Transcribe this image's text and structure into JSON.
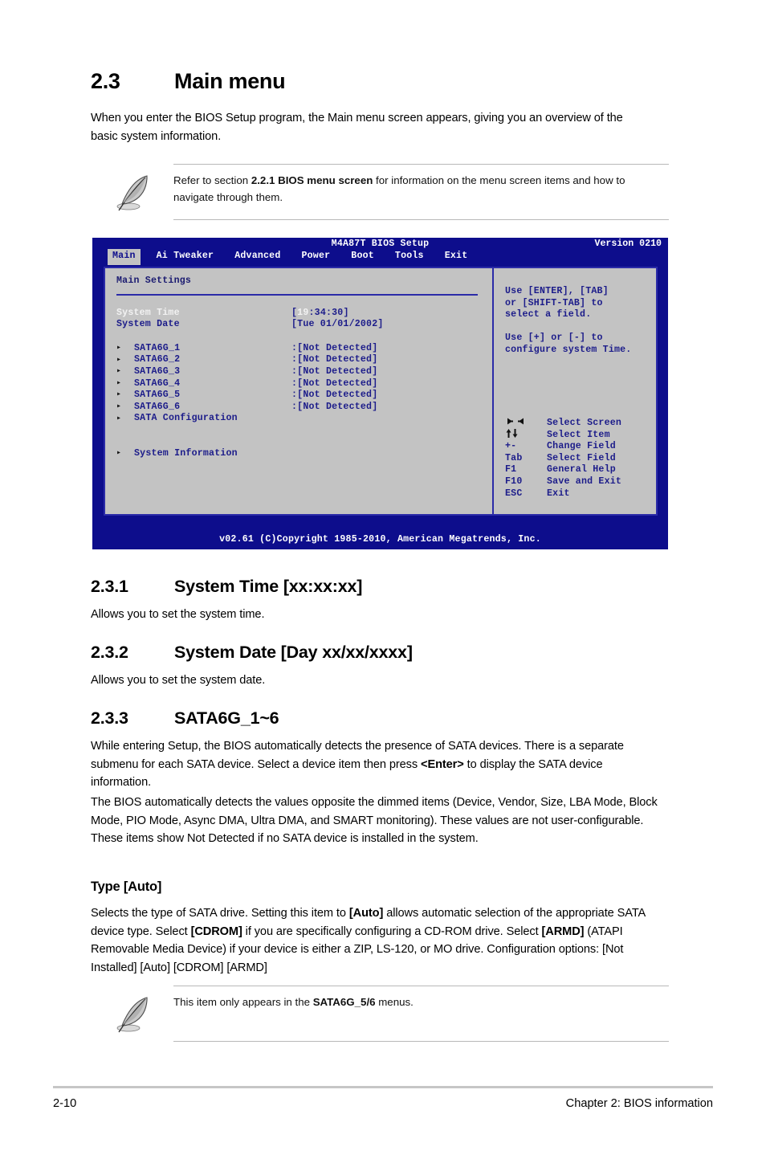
{
  "section": {
    "number": "2.3",
    "title": "Main menu",
    "intro": "When you enter the BIOS Setup program, the Main menu screen appears, giving you an overview of the basic system information."
  },
  "note_top": {
    "icon": "feather-pen-icon",
    "text_before": "Refer to section ",
    "bold": "2.2.1 BIOS menu screen",
    "text_after": " for information on the menu screen items and how to navigate through them."
  },
  "bios": {
    "title": "M4A87T BIOS Setup",
    "version": "Version 0210",
    "tabs": [
      {
        "label": "Main",
        "active": true
      },
      {
        "label": "Ai Tweaker",
        "active": false
      },
      {
        "label": "Advanced",
        "active": false
      },
      {
        "label": "Power",
        "active": false
      },
      {
        "label": "Boot",
        "active": false
      },
      {
        "label": "Tools",
        "active": false
      },
      {
        "label": "Exit",
        "active": false
      }
    ],
    "panel_title": "Main Settings",
    "fields": [
      {
        "label": "System Time",
        "value": "[19:34:30]",
        "cursor": "19",
        "selected": true
      },
      {
        "label": "System Date",
        "value": "[Tue 01/01/2002]",
        "selected": false
      }
    ],
    "items": [
      {
        "arrow": "triangle-right-icon",
        "name": "SATA6G_1",
        "state": ":[Not Detected]"
      },
      {
        "arrow": "triangle-right-icon",
        "name": "SATA6G_2",
        "state": ":[Not Detected]"
      },
      {
        "arrow": "triangle-right-icon",
        "name": "SATA6G_3",
        "state": ":[Not Detected]"
      },
      {
        "arrow": "triangle-right-icon",
        "name": "SATA6G_4",
        "state": ":[Not Detected]"
      },
      {
        "arrow": "triangle-right-icon",
        "name": "SATA6G_5",
        "state": ":[Not Detected]"
      },
      {
        "arrow": "triangle-right-icon",
        "name": "SATA6G_6",
        "state": ":[Not Detected]"
      },
      {
        "arrow": "triangle-right-icon",
        "name": "SATA Configuration",
        "state": ""
      }
    ],
    "items2": [
      {
        "arrow": "triangle-right-icon",
        "name": "System Information",
        "state": ""
      }
    ],
    "help": [
      "Use [ENTER], [TAB]\nor [SHIFT-TAB] to\nselect a field.",
      "Use [+] or [-] to\nconfigure system Time."
    ],
    "legend": [
      {
        "key": "←→",
        "key_icon": "left-right-arrow-icon",
        "desc": "Select Screen",
        "glyph": true
      },
      {
        "key": "↑↓",
        "key_icon": "up-down-arrow-icon",
        "desc": "Select Item",
        "glyph": true
      },
      {
        "key": "+-",
        "key_icon": "plus-minus-icon",
        "desc": "Change Field",
        "glyph": false
      },
      {
        "key": "Tab",
        "key_icon": "tab-key-icon",
        "desc": "Select Field",
        "glyph": false
      },
      {
        "key": "F1",
        "key_icon": "f1-key-icon",
        "desc": "General Help",
        "glyph": false
      },
      {
        "key": "F10",
        "key_icon": "f10-key-icon",
        "desc": "Save and Exit",
        "glyph": false
      },
      {
        "key": "ESC",
        "key_icon": "esc-key-icon",
        "desc": "Exit",
        "glyph": false
      }
    ],
    "footer": "v02.61 (C)Copyright 1985-2010, American Megatrends, Inc.",
    "colors": {
      "background": "#0d0d8c",
      "panel": "#c3c3c3",
      "panel_border": "#2b2ba8",
      "text_blue": "#1c1c8a",
      "text_white": "#ffffff"
    }
  },
  "subsections": [
    {
      "number": "2.3.1",
      "title": "System Time [xx:xx:xx]",
      "body": "Allows you to set the system time."
    },
    {
      "number": "2.3.2",
      "title": "System Date [Day xx/xx/xxxx]",
      "body": "Allows you to set the system date."
    },
    {
      "number": "2.3.3",
      "title": "SATA6G_1~6",
      "para1_a": "While entering Setup, the BIOS automatically detects the presence of SATA devices. There is a separate submenu for each SATA device. Select a device item then press ",
      "para1_bold": "<Enter>",
      "para1_b": " to display the SATA device information.",
      "para2": "The BIOS automatically detects the values opposite the dimmed items (Device, Vendor, Size, LBA Mode, Block Mode, PIO Mode, Async DMA, Ultra DMA, and SMART monitoring). These values are not user-configurable. These items show Not Detected if no SATA device is installed in the system."
    }
  ],
  "type_section": {
    "heading": "Type [Auto]",
    "p_a": "Selects the type of SATA drive. Setting this item to ",
    "b1": "[Auto]",
    "p_b": " allows automatic selection of the appropriate SATA device type. Select ",
    "b2": "[CDROM]",
    "p_c": " if you are specifically configuring a CD-ROM drive. Select ",
    "b3": "[ARMD]",
    "p_d": " (ATAPI Removable Media Device) if your device is either a ZIP, LS-120, or MO drive. Configuration options: [Not Installed] [Auto] [CDROM] [ARMD]"
  },
  "note_bottom": {
    "icon": "feather-pen-icon",
    "text_before": "This item only appears in the ",
    "bold": "SATA6G_5/6",
    "text_after": " menus."
  },
  "page_footer": {
    "page_number": "2-10",
    "chapter": "Chapter 2: BIOS information"
  }
}
